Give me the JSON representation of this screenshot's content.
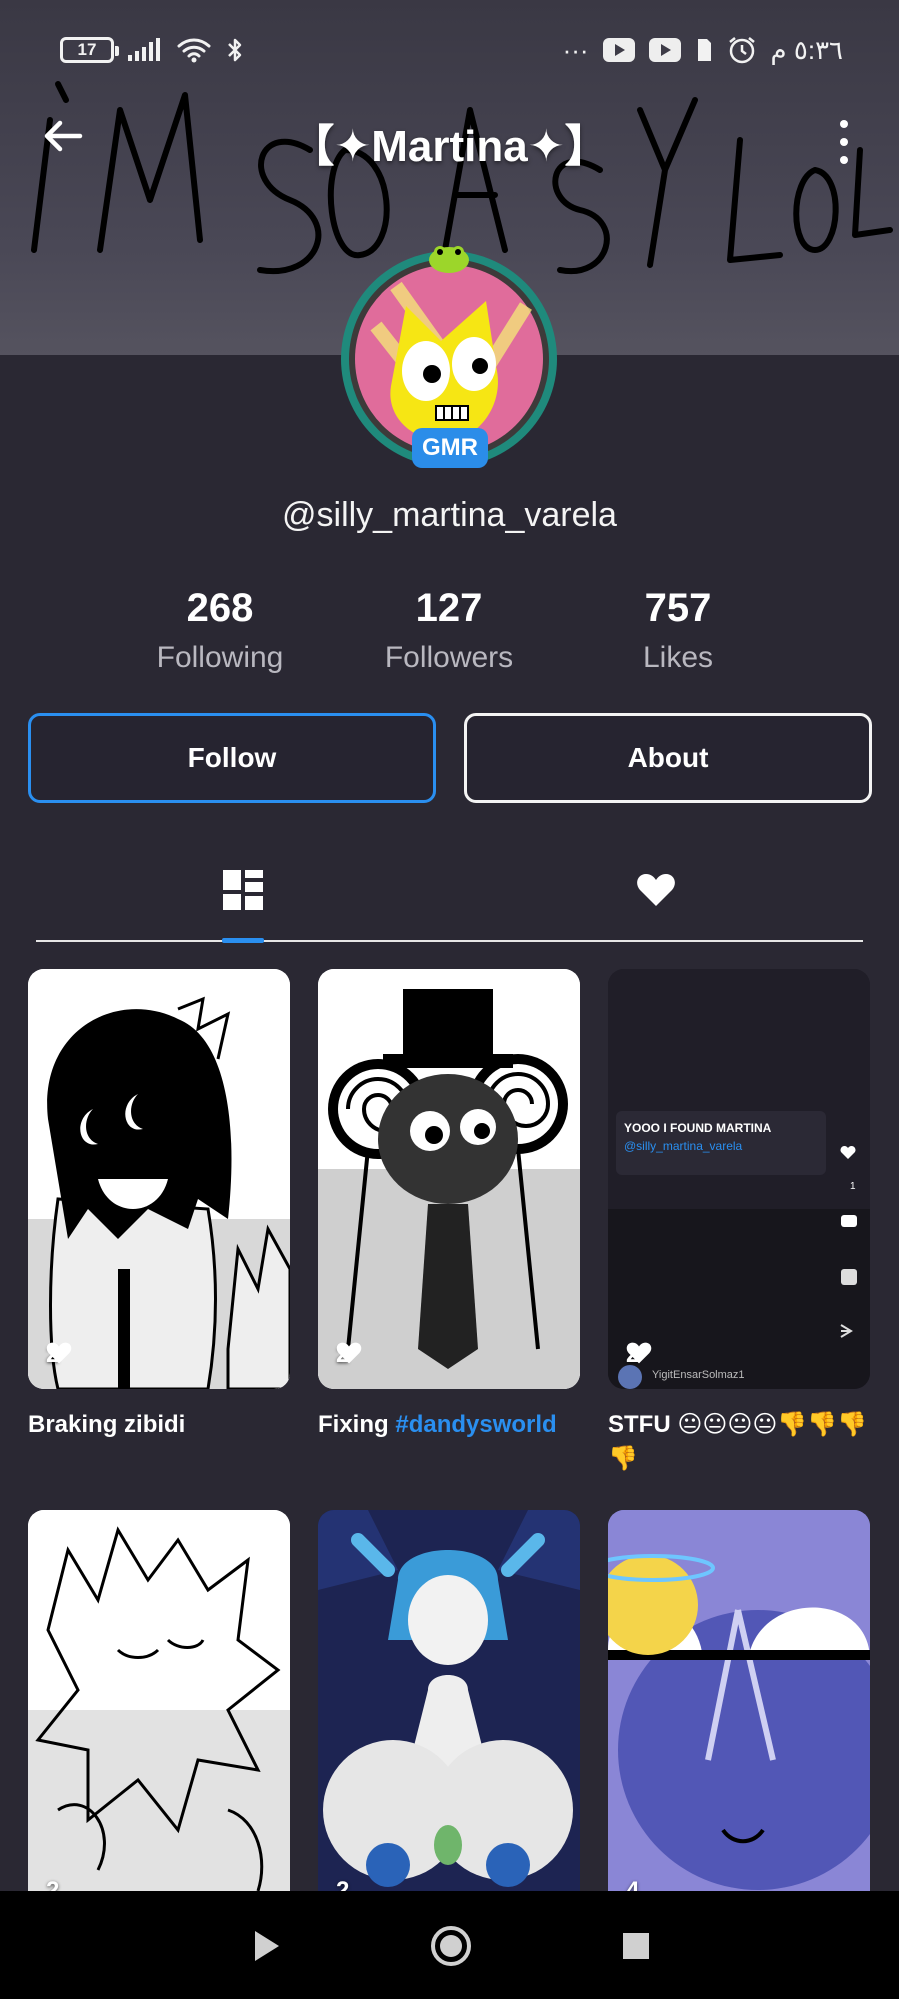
{
  "status_bar": {
    "battery": "17",
    "time": "٥:٣٦ م",
    "dots": "···"
  },
  "header": {
    "title": "【✦Martina✦】",
    "banner_scribble": "I'M SO EASY LOL"
  },
  "profile": {
    "badge": "GMR",
    "handle": "@silly_martina_varela",
    "stats": [
      {
        "value": "268",
        "label": "Following"
      },
      {
        "value": "127",
        "label": "Followers"
      },
      {
        "value": "757",
        "label": "Likes"
      }
    ]
  },
  "actions": {
    "follow_label": "Follow",
    "about_label": "About"
  },
  "tabs": [
    {
      "icon": "grid-icon",
      "active": true
    },
    {
      "icon": "heart-icon",
      "active": false
    }
  ],
  "posts": [
    {
      "likes": "2",
      "caption": "Braking zibidi"
    },
    {
      "likes": "2",
      "caption_text": "Fixing ",
      "caption_tag": "#dandysworld"
    },
    {
      "likes": "2",
      "caption": "STFU 😐😐😐😐👎👎👎👎",
      "overlay_text": "YOOO I FOUND MARTINA",
      "overlay_handle": "@silly_martina_varela",
      "overlay_user": "YigitEnsarSolmaz1",
      "overlay_like_count": "1"
    },
    {
      "likes": "2"
    },
    {
      "likes": "2"
    },
    {
      "likes": "4"
    }
  ],
  "colors": {
    "background": "#2a2833",
    "accent": "#2a8ff0",
    "navbar": "#000000"
  }
}
